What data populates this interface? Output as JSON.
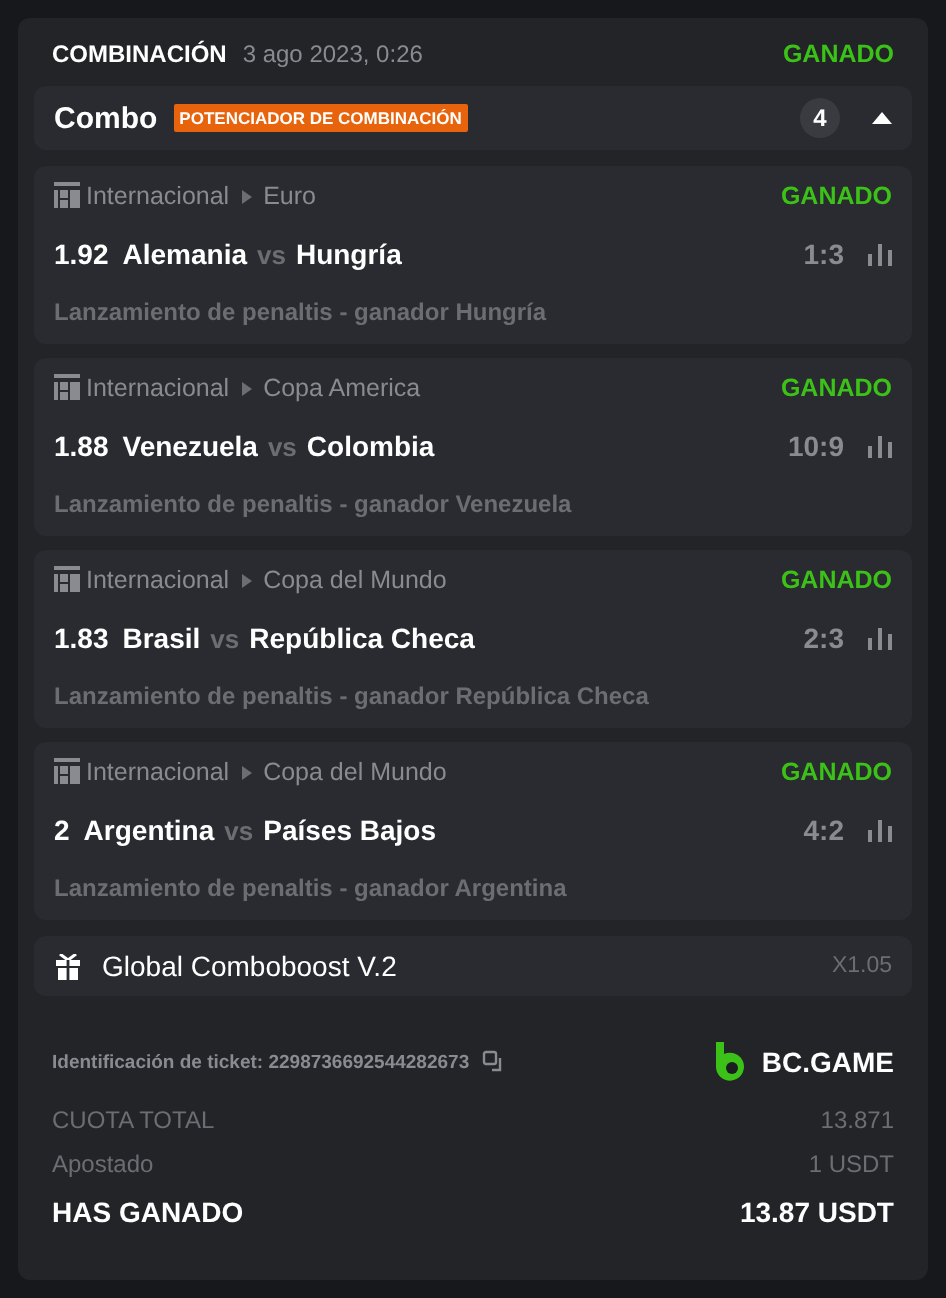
{
  "header": {
    "title": "COMBINACIÓN",
    "date": "3 ago 2023, 0:26",
    "status": "GANADO"
  },
  "combo": {
    "title": "Combo",
    "badge": "POTENCIADOR DE COMBINACIÓN",
    "count": "4",
    "expanded": true
  },
  "matches": [
    {
      "league": "Internacional",
      "tournament": "Euro",
      "status": "GANADO",
      "odds": "1.92",
      "home": "Alemania",
      "vs": "vs",
      "away": "Hungría",
      "score": "1:3",
      "market": "Lanzamiento de penaltis - ganador Hungría"
    },
    {
      "league": "Internacional",
      "tournament": "Copa America",
      "status": "GANADO",
      "odds": "1.88",
      "home": "Venezuela",
      "vs": "vs",
      "away": "Colombia",
      "score": "10:9",
      "market": "Lanzamiento de penaltis - ganador Venezuela"
    },
    {
      "league": "Internacional",
      "tournament": "Copa del Mundo",
      "status": "GANADO",
      "odds": "1.83",
      "home": "Brasil",
      "vs": "vs",
      "away": "República Checa",
      "score": "2:3",
      "market": "Lanzamiento de penaltis - ganador República Checa"
    },
    {
      "league": "Internacional",
      "tournament": "Copa del Mundo",
      "status": "GANADO",
      "odds": "2",
      "home": "Argentina",
      "vs": "vs",
      "away": "Países Bajos",
      "score": "4:2",
      "market": "Lanzamiento de penaltis - ganador Argentina"
    }
  ],
  "boost": {
    "label": "Global Comboboost V.2",
    "value": "X1.05"
  },
  "ticket": {
    "label": "Identificación de ticket: 2298736692544282673",
    "brand": "BC.GAME"
  },
  "totals": [
    {
      "kind": "normal",
      "label": "CUOTA TOTAL",
      "value": "13.871"
    },
    {
      "kind": "normal",
      "label": "Apostado",
      "value": "1 USDT"
    },
    {
      "kind": "strong",
      "label": "HAS GANADO",
      "value": "13.87 USDT"
    }
  ]
}
